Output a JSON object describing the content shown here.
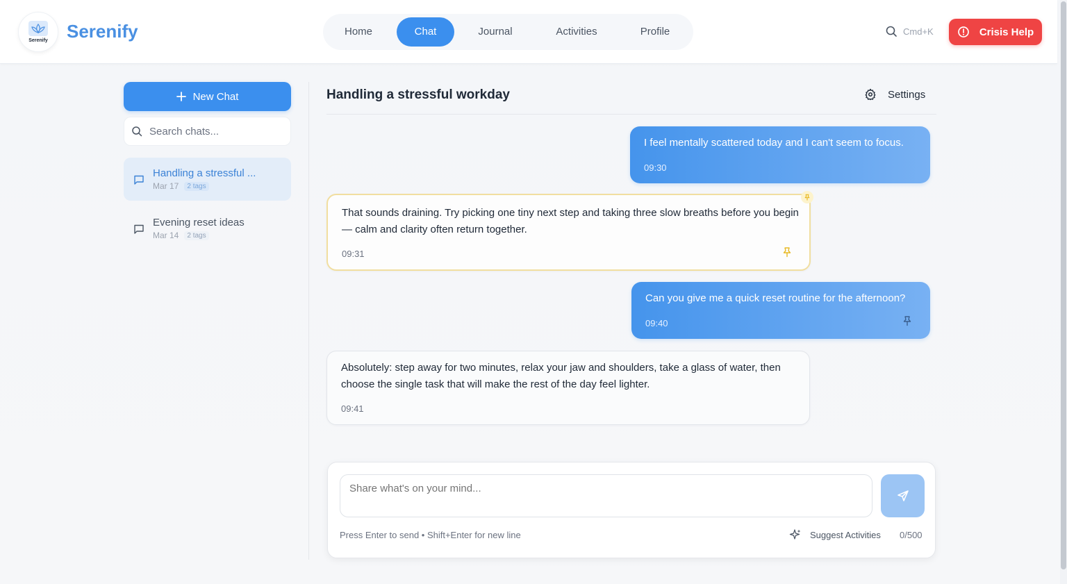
{
  "app": {
    "brand": "Serenify",
    "logo_text": "Serenify"
  },
  "nav": {
    "items": [
      {
        "label": "Home",
        "active": false
      },
      {
        "label": "Chat",
        "active": true
      },
      {
        "label": "Journal",
        "active": false
      },
      {
        "label": "Activities",
        "active": false
      },
      {
        "label": "Profile",
        "active": false
      }
    ]
  },
  "header": {
    "search_shortcut": "Cmd+K",
    "crisis_label": "Crisis Help"
  },
  "sidebar": {
    "new_chat_label": "New Chat",
    "search_placeholder": "Search chats...",
    "chats": [
      {
        "title": "Handling a stressful ...",
        "date": "Mar 17",
        "tags": "2 tags",
        "active": true
      },
      {
        "title": "Evening reset ideas",
        "date": "Mar 14",
        "tags": "2 tags",
        "active": false
      }
    ]
  },
  "chat": {
    "title": "Handling a stressful workday",
    "settings_label": "Settings",
    "messages": [
      {
        "role": "user",
        "text": "I feel mentally scattered today and I can't seem to focus.",
        "time": "09:30"
      },
      {
        "role": "assistant",
        "text": "That sounds draining. Try picking one tiny next step and taking three slow breaths before you begin — calm and clarity often return together.",
        "time": "09:31",
        "pinned": true
      },
      {
        "role": "user",
        "text": "Can you give me a quick reset routine for the afternoon?",
        "time": "09:40"
      },
      {
        "role": "assistant",
        "text": "Absolutely: step away for two minutes, relax your jaw and shoulders, take a glass of water, then choose the single task that will make the rest of the day feel lighter.",
        "time": "09:41"
      }
    ]
  },
  "composer": {
    "placeholder": "Share what's on your mind...",
    "hint": "Press Enter to send • Shift+Enter for new line",
    "suggest_label": "Suggest Activities",
    "counter": "0/500"
  },
  "colors": {
    "accent": "#3b8fee",
    "brand": "#4a90e2",
    "danger": "#ef4444",
    "pin": "#e8b923"
  }
}
